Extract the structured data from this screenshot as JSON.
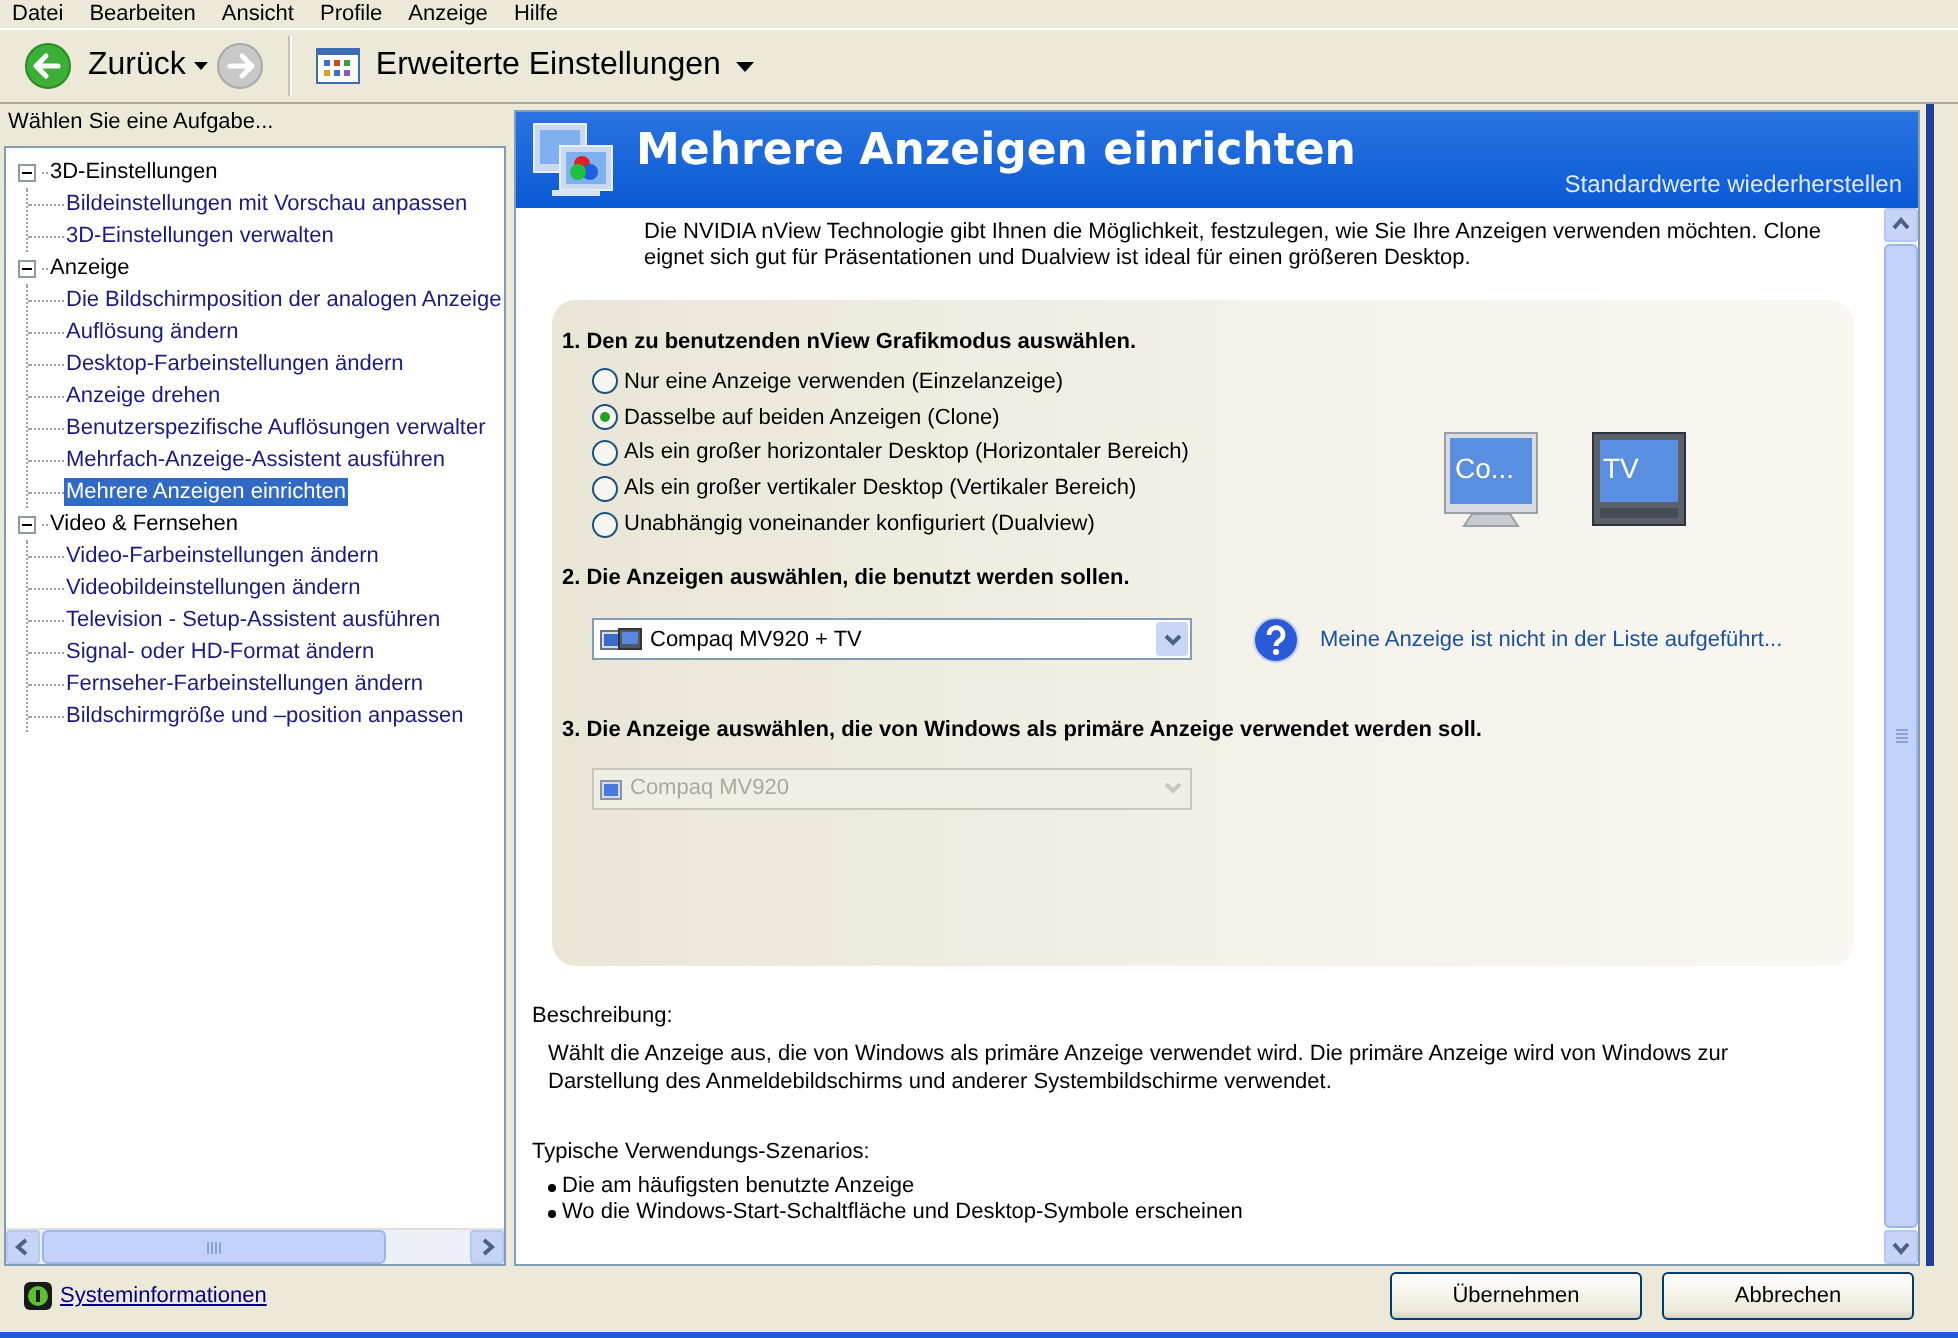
{
  "menu_bar": [
    "Datei",
    "Bearbeiten",
    "Ansicht",
    "Profile",
    "Anzeige",
    "Hilfe"
  ],
  "toolbar": {
    "back": {
      "label": "Zurück",
      "disabled": false
    },
    "forward": {
      "disabled": true
    },
    "view": {
      "label": "Erweiterte Einstellungen"
    }
  },
  "sidebar": {
    "title": "Wählen Sie eine Aufgabe...",
    "items": [
      {
        "label": "3D-Einstellungen",
        "expanded": true,
        "selected": false,
        "children": [
          {
            "label": "Bildeinstellungen mit Vorschau anpassen",
            "selected": false
          },
          {
            "label": "3D-Einstellungen verwalten",
            "selected": false
          }
        ]
      },
      {
        "label": "Anzeige",
        "expanded": true,
        "selected": false,
        "children": [
          {
            "label": "Die Bildschirmposition der analogen Anzeige",
            "selected": false
          },
          {
            "label": "Auflösung ändern",
            "selected": false
          },
          {
            "label": "Desktop-Farbeinstellungen ändern",
            "selected": false
          },
          {
            "label": "Anzeige drehen",
            "selected": false
          },
          {
            "label": "Benutzerspezifische Auflösungen verwalter",
            "selected": false
          },
          {
            "label": "Mehrfach-Anzeige-Assistent ausführen",
            "selected": false
          },
          {
            "label": "Mehrere Anzeigen einrichten",
            "selected": true
          }
        ]
      },
      {
        "label": "Video & Fernsehen",
        "expanded": true,
        "selected": false,
        "children": [
          {
            "label": "Video-Farbeinstellungen ändern",
            "selected": false
          },
          {
            "label": "Videobildeinstellungen ändern",
            "selected": false
          },
          {
            "label": "Television - Setup-Assistent ausführen",
            "selected": false
          },
          {
            "label": "Signal- oder HD-Format ändern",
            "selected": false
          },
          {
            "label": "Fernseher-Farbeinstellungen ändern",
            "selected": false
          },
          {
            "label": "Bildschirmgröße und –position anpassen",
            "selected": false
          }
        ]
      }
    ],
    "footer_link": "Systeminformationen"
  },
  "page": {
    "title": "Mehrere Anzeigen einrichten",
    "restore_link": "Standardwerte wiederherstellen",
    "intro": "Die NVIDIA nView Technologie gibt Ihnen die Möglichkeit, festzulegen, wie Sie Ihre Anzeigen verwenden möchten. Clone eignet sich gut für Präsentationen und Dualview ist ideal für einen größeren Desktop.",
    "steps": [
      {
        "kind": "radio_group",
        "title": "1. Den zu benutzenden nView Grafikmodus auswählen.",
        "options": [
          {
            "label": "Nur eine Anzeige verwenden (Einzelanzeige)",
            "selected": false
          },
          {
            "label": "Dasselbe auf beiden Anzeigen (Clone)",
            "selected": true
          },
          {
            "label": "Als ein großer horizontaler Desktop (Horizontaler Bereich)",
            "selected": false
          },
          {
            "label": "Als ein großer vertikaler Desktop (Vertikaler Bereich)",
            "selected": false
          },
          {
            "label": "Unabhängig voneinander konfiguriert (Dualview)",
            "selected": false
          }
        ],
        "displays": [
          {
            "kind": "monitor",
            "label": "Co..."
          },
          {
            "kind": "tv",
            "label": "TV"
          }
        ]
      },
      {
        "kind": "dropdown",
        "title": "2. Die Anzeigen auswählen, die benutzt werden sollen.",
        "dropdown": {
          "value": "Compaq MV920 + TV",
          "disabled": false
        },
        "help_link": "Meine Anzeige ist nicht in der Liste aufgeführt..."
      },
      {
        "kind": "dropdown",
        "title": "3. Die Anzeige auswählen, die von Windows als primäre Anzeige verwendet werden soll.",
        "dropdown": {
          "value": "Compaq MV920",
          "disabled": true
        }
      }
    ],
    "description": {
      "label": "Beschreibung:",
      "text": "Wählt die Anzeige aus, die von Windows als primäre Anzeige verwendet wird. Die primäre Anzeige wird von Windows zur Darstellung des Anmeldebildschirms und anderer Systembildschirme verwendet."
    },
    "scenarios": {
      "label": "Typische Verwendungs-Szenarios:",
      "items": [
        "Die am häufigsten benutzte Anzeige",
        "Wo die Windows-Start-Schaltfläche und Desktop-Symbole erscheinen"
      ]
    }
  },
  "buttons": [
    "Übernehmen",
    "Abbrechen"
  ]
}
